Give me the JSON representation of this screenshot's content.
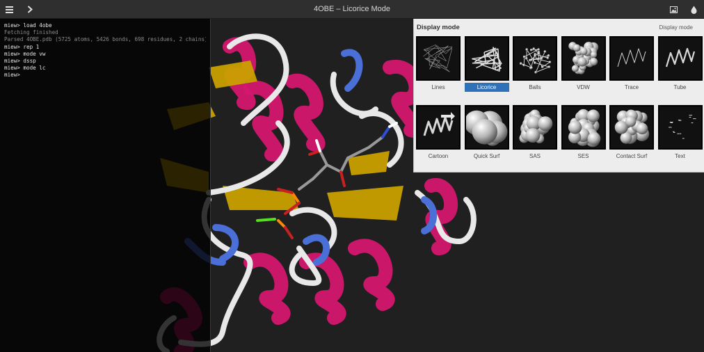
{
  "app": {
    "title": "4OBE – Licorice Mode"
  },
  "toolbar": {
    "menu_icon": "hamburger-menu-icon",
    "terminal_icon": "chevron-right-icon",
    "display_mode_icon": "image-icon",
    "color_icon": "droplet-icon"
  },
  "terminal": {
    "lines": [
      {
        "text": "miew> load 4obe",
        "kind": "cmd"
      },
      {
        "text": "Fetching finished",
        "kind": "out"
      },
      {
        "text": "Parsed 4OBE.pdb (5725 atoms, 5426 bonds, 698 residues, 2 chains).",
        "kind": "out"
      },
      {
        "text": "miew> rep 1",
        "kind": "cmd"
      },
      {
        "text": "miew> mode vw",
        "kind": "cmd"
      },
      {
        "text": "miew> dssp",
        "kind": "cmd"
      },
      {
        "text": "miew> mode lc",
        "kind": "cmd"
      },
      {
        "text": "miew>",
        "kind": "cmd"
      }
    ]
  },
  "panel": {
    "title": "Display mode",
    "right_label": "Display mode",
    "selected": "Licorice",
    "modes": [
      {
        "label": "Lines",
        "icon": "lines-thumbnail"
      },
      {
        "label": "Licorice",
        "icon": "licorice-thumbnail"
      },
      {
        "label": "Balls",
        "icon": "balls-thumbnail"
      },
      {
        "label": "VDW",
        "icon": "vdw-thumbnail"
      },
      {
        "label": "Trace",
        "icon": "trace-thumbnail"
      },
      {
        "label": "Tube",
        "icon": "tube-thumbnail"
      },
      {
        "label": "Cartoon",
        "icon": "cartoon-thumbnail"
      },
      {
        "label": "Quick Surf",
        "icon": "quick-surf-thumbnail"
      },
      {
        "label": "SAS",
        "icon": "sas-thumbnail"
      },
      {
        "label": "SES",
        "icon": "ses-thumbnail"
      },
      {
        "label": "Contact Surf",
        "icon": "contact-surf-thumbnail"
      },
      {
        "label": "Text",
        "icon": "text-thumbnail"
      }
    ]
  },
  "colors": {
    "helix": "#d4176f",
    "sheet": "#c9a000",
    "turn": "#4a6fd6",
    "coil": "#e8e8e8",
    "accent": "#2f72b8"
  }
}
